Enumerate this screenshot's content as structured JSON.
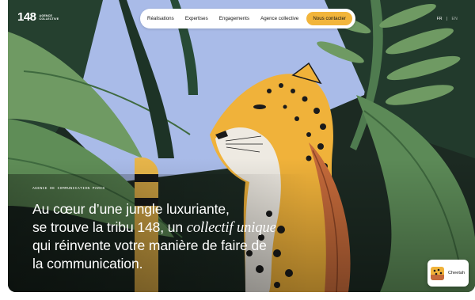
{
  "logo": {
    "number": "148",
    "line1": "AGENCE",
    "line2": "COLLECTIVE"
  },
  "nav": {
    "items": [
      {
        "label": "Réalisations"
      },
      {
        "label": "Expertises"
      },
      {
        "label": "Engagements"
      },
      {
        "label": "Agence collective"
      }
    ],
    "cta": "Nous contacter"
  },
  "lang": {
    "active": "FR",
    "separator": "|",
    "inactive": "EN"
  },
  "hero": {
    "eyebrow": "AGENCE DE COMMUNICATION PARIS",
    "headline_part1": "Au cœur d’une jungle luxuriante,",
    "headline_part2": "se trouve la tribu 148, un ",
    "headline_accent": "collectif unique",
    "headline_part3": "qui réinvente votre manière de faire de",
    "headline_part4": "la communication."
  },
  "badge": {
    "label": "Cheetah",
    "icon": "cheetah-icon"
  },
  "colors": {
    "accent": "#f2b53b",
    "sky": "#a6b8e6",
    "leaf_light": "#5e8a5a",
    "leaf_dark": "#1f3b2c",
    "cheetah": "#f0b23a"
  }
}
